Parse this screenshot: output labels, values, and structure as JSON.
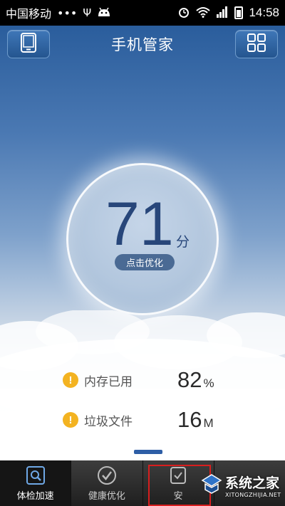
{
  "status_bar": {
    "carrier": "中国移动",
    "dots": "•••",
    "time": "14:58"
  },
  "header": {
    "title": "手机管家"
  },
  "score": {
    "value": "71",
    "unit": "分",
    "button_label": "点击优化"
  },
  "stats": [
    {
      "label": "内存已用",
      "value": "82",
      "unit": "%"
    },
    {
      "label": "垃圾文件",
      "value": "16",
      "unit": "M"
    }
  ],
  "tabs": [
    {
      "label": "体检加速",
      "icon": "search-icon",
      "active": true
    },
    {
      "label": "健康优化",
      "icon": "check-icon",
      "active": false
    },
    {
      "label": "安",
      "icon": "shield-icon",
      "active": false
    }
  ],
  "watermark": {
    "main": "系统之家",
    "sub": "XITONGZHIJIA.NET"
  },
  "colors": {
    "accent": "#2a5d9c",
    "score_text": "#27467a",
    "warning": "#f3b321",
    "highlight": "#d81e1e"
  }
}
